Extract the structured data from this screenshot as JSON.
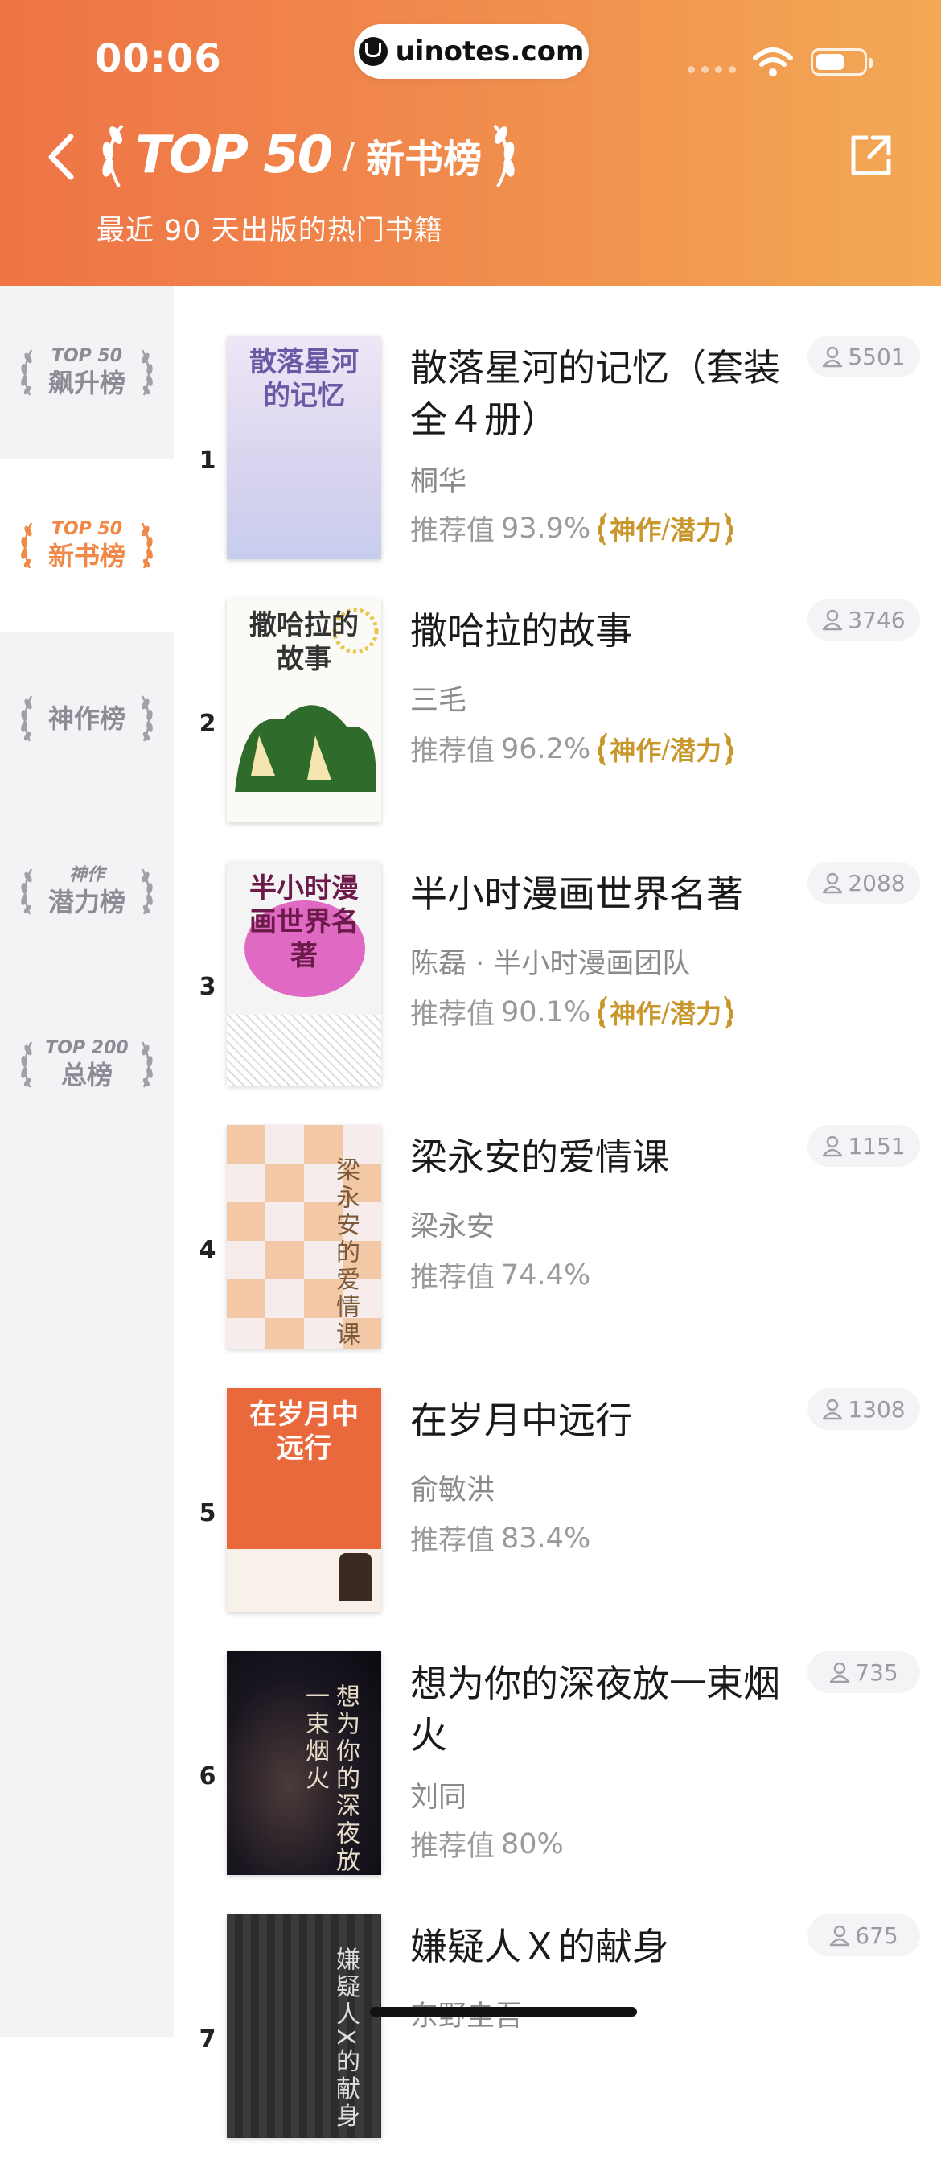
{
  "status_bar": {
    "time": "00:06",
    "url": "uinotes.com"
  },
  "header": {
    "title_logo": "TOP 50",
    "title_sep": "/",
    "title": "新书榜",
    "subtitle": "最近 90 天出版的热门书籍"
  },
  "sidebar": {
    "items": [
      {
        "small": "TOP 50",
        "big": "飙升榜",
        "active": false
      },
      {
        "small": "TOP 50",
        "big": "新书榜",
        "active": true
      },
      {
        "small": "",
        "big": "神作榜",
        "active": false
      },
      {
        "small": "神作",
        "big": "潜力榜",
        "active": false
      },
      {
        "small": "TOP 200",
        "big": "总榜",
        "active": false
      }
    ]
  },
  "labels": {
    "rec_prefix": "推荐值",
    "badge_a": "神作",
    "badge_sep": "/",
    "badge_b": "潜力"
  },
  "books": [
    {
      "rank": "1",
      "title": "散落星河的记忆（套装全４册）",
      "author": "桐华",
      "rec": "93.9%",
      "badge": true,
      "count": "5501",
      "cover_text": "散落星河的记忆"
    },
    {
      "rank": "2",
      "title": "撒哈拉的故事",
      "author": "三毛",
      "rec": "96.2%",
      "badge": true,
      "count": "3746",
      "cover_text": "撒哈拉的故事"
    },
    {
      "rank": "3",
      "title": "半小时漫画世界名著",
      "author": "陈磊 · 半小时漫画团队",
      "rec": "90.1%",
      "badge": true,
      "count": "2088",
      "cover_text": "半小时漫画世界名著"
    },
    {
      "rank": "4",
      "title": "梁永安的爱情课",
      "author": "梁永安",
      "rec": "74.4%",
      "badge": false,
      "count": "1151",
      "cover_text": "梁永安的爱情课"
    },
    {
      "rank": "5",
      "title": "在岁月中远行",
      "author": "俞敏洪",
      "rec": "83.4%",
      "badge": false,
      "count": "1308",
      "cover_text": "在岁月中远行"
    },
    {
      "rank": "6",
      "title": "想为你的深夜放一束烟火",
      "author": "刘同",
      "rec": "80%",
      "badge": false,
      "count": "735",
      "cover_text": "想为你的深夜放一束烟火"
    },
    {
      "rank": "7",
      "title": "嫌疑人Ｘ的献身",
      "author": "东野圭吾",
      "rec": "",
      "badge": false,
      "count": "675",
      "cover_text": "嫌疑人X的献身"
    }
  ],
  "colors": {
    "accent": "#f08847",
    "badge_gold": "#c9962a",
    "header_left": "#ef7446",
    "header_right": "#f3a955"
  }
}
